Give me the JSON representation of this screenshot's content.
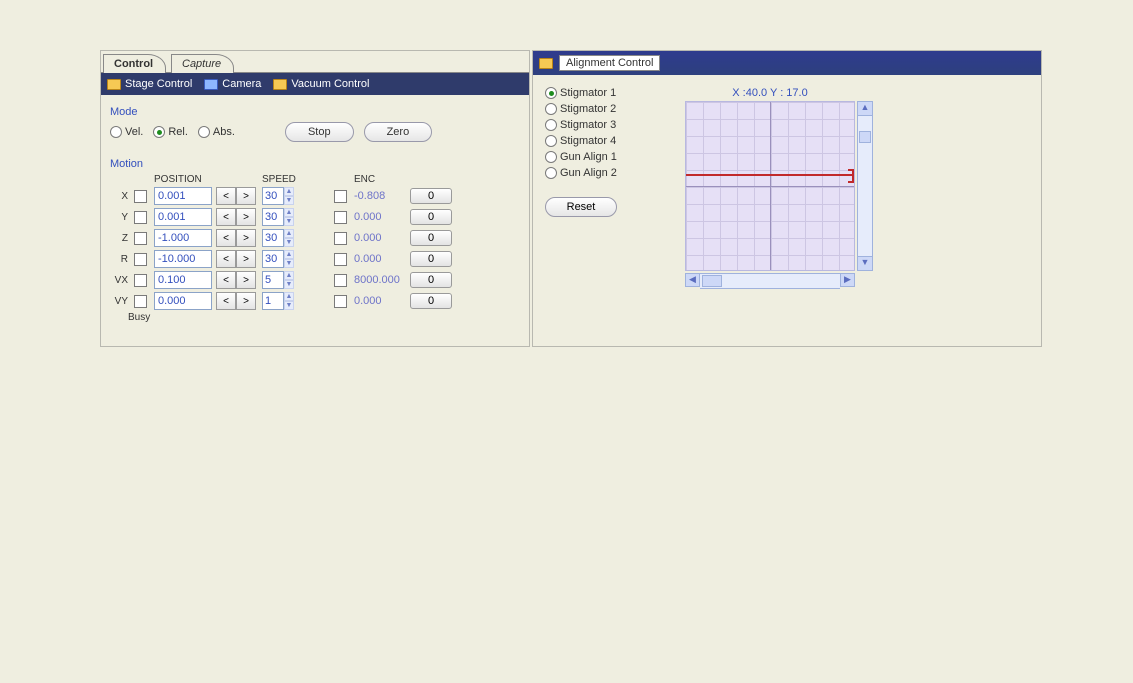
{
  "tabs": {
    "control": "Control",
    "capture": "Capture"
  },
  "subtabs": {
    "stage": "Stage Control",
    "camera": "Camera",
    "vacuum": "Vacuum Control"
  },
  "mode": {
    "title": "Mode",
    "vel": "Vel.",
    "rel": "Rel.",
    "abs": "Abs.",
    "selected": "rel",
    "stop": "Stop",
    "zero": "Zero"
  },
  "motion": {
    "title": "Motion",
    "hdr_position": "POSITION",
    "hdr_speed": "SPEED",
    "hdr_enc": "ENC",
    "axes": [
      {
        "label": "X",
        "pos": "0.001",
        "speed": "30",
        "enc": "-0.808",
        "zero": "0"
      },
      {
        "label": "Y",
        "pos": "0.001",
        "speed": "30",
        "enc": "0.000",
        "zero": "0"
      },
      {
        "label": "Z",
        "pos": "-1.000",
        "speed": "30",
        "enc": "0.000",
        "zero": "0"
      },
      {
        "label": "R",
        "pos": "-10.000",
        "speed": "30",
        "enc": "0.000",
        "zero": "0"
      },
      {
        "label": "VX",
        "pos": "0.100",
        "speed": "5",
        "enc": "8000.000",
        "zero": "0"
      },
      {
        "label": "VY",
        "pos": "0.000",
        "speed": "1",
        "enc": "0.000",
        "zero": "0"
      }
    ],
    "busy": "Busy"
  },
  "right": {
    "title": "Alignment Control",
    "coords": "X :40.0 Y : 17.0",
    "reset": "Reset",
    "radios": [
      "Stigmator 1",
      "Stigmator 2",
      "Stigmator 3",
      "Stigmator 4",
      "Gun Align 1",
      "Gun Align 2"
    ],
    "selected": 0
  }
}
